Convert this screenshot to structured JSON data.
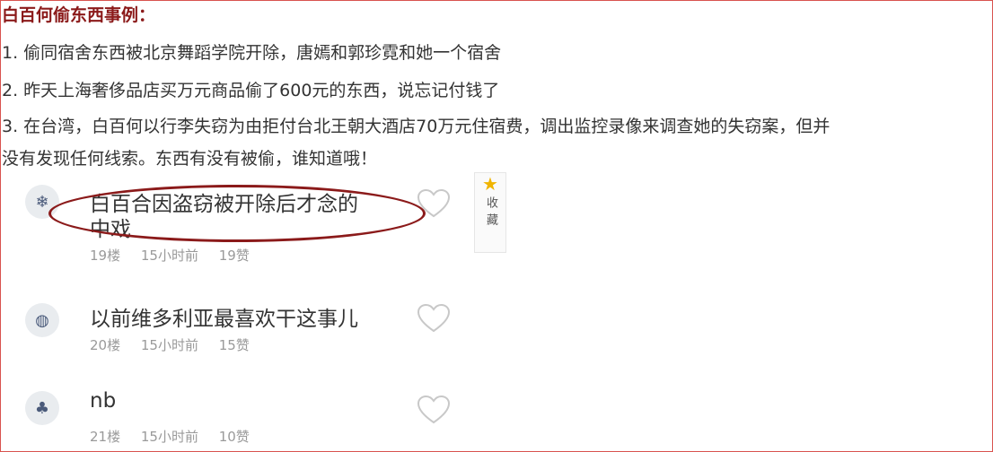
{
  "article": {
    "heading": "白百何偷东西事例：",
    "lines": [
      "1. 偷同宿舍东西被北京舞蹈学院开除，唐嫣和郭珍霓和她一个宿舍",
      "2. 昨天上海奢侈品店买万元商品偷了600元的东西，说忘记付钱了",
      "3. 在台湾，白百何以行李失窃为由拒付台北王朝大酒店70万元住宿费，调出监控录像来调查她的失窃案，但并",
      "没有发现任何线索。东西有没有被偷，谁知道哦！"
    ]
  },
  "favorite": {
    "star_icon": "star-icon",
    "label": "收藏"
  },
  "comments": [
    {
      "avatar_icon": "snowflake-avatar-icon",
      "text_line1": "白百合因盗窃被开除后才念的",
      "text_line2": "中戏",
      "floor": "19楼",
      "time": "15小时前",
      "likes": "19赞"
    },
    {
      "avatar_icon": "shell-avatar-icon",
      "text_line1": "以前维多利亚最喜欢干这事儿",
      "floor": "20楼",
      "time": "15小时前",
      "likes": "15赞"
    },
    {
      "avatar_icon": "tree-avatar-icon",
      "text_line1": "nb",
      "floor": "21楼",
      "time": "15小时前",
      "likes": "10赞"
    }
  ],
  "colors": {
    "highlight_ring": "#8b1a1a",
    "heading": "#8b1a1a",
    "frame": "#d9534f"
  }
}
